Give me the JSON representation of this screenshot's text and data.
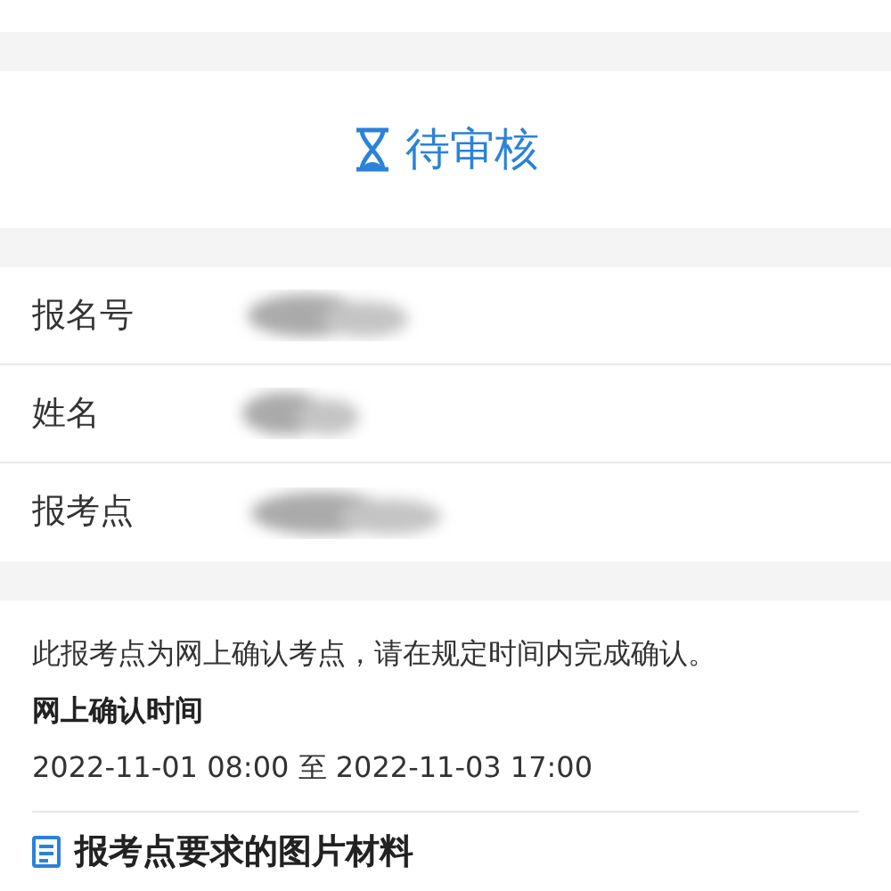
{
  "status": {
    "label": "待审核"
  },
  "fields": [
    {
      "label": "报名号",
      "redacted": true
    },
    {
      "label": "姓名",
      "redacted": true
    },
    {
      "label": "报考点",
      "redacted": true
    }
  ],
  "notice": "此报考点为网上确认考点，请在规定时间内完成确认。",
  "confirm_time": {
    "title": "网上确认时间",
    "value": "2022-11-01 08:00 至 2022-11-03 17:00"
  },
  "materials": {
    "title": "报考点要求的图片材料"
  }
}
